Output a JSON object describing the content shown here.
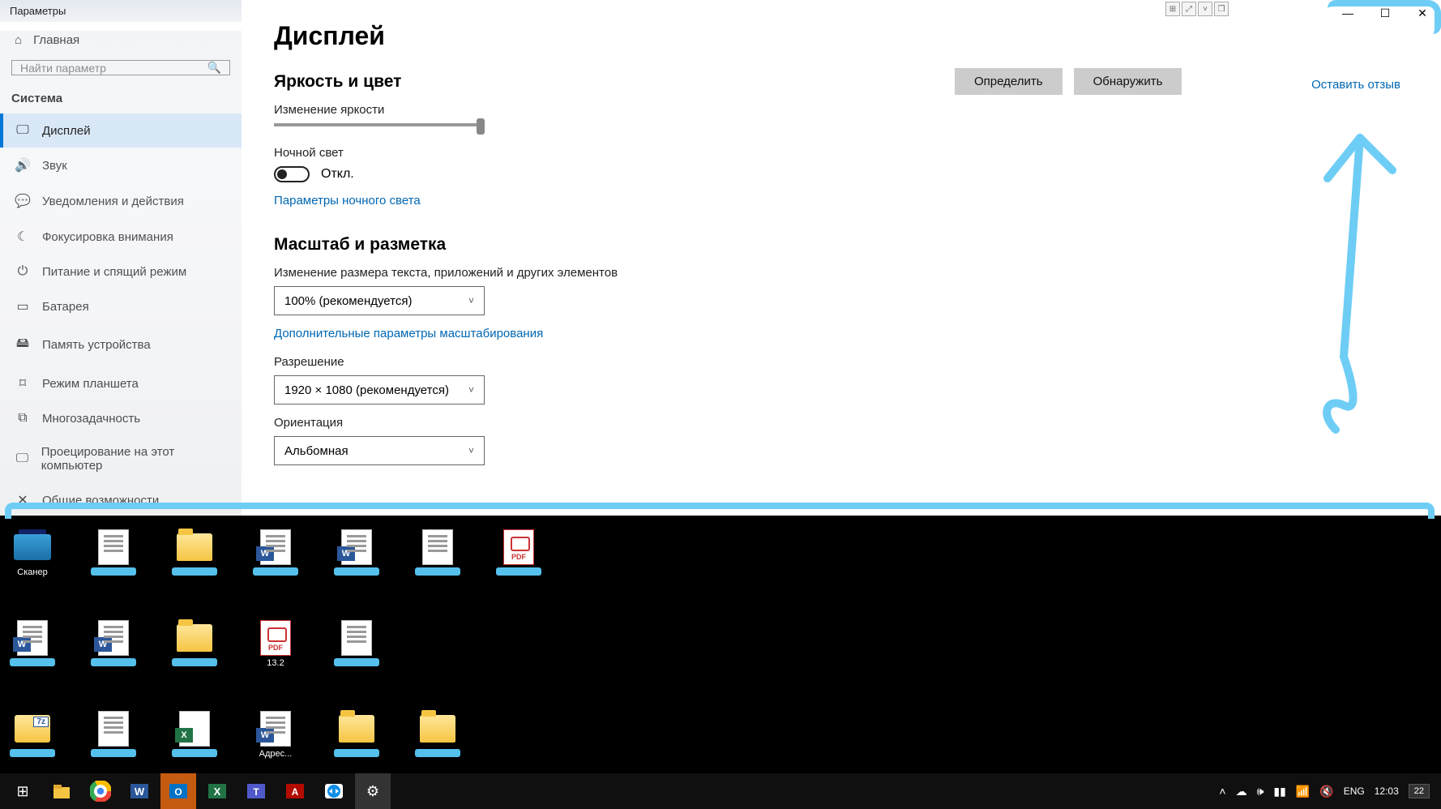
{
  "window": {
    "title": "Параметры",
    "home": "Главная",
    "search_placeholder": "Найти параметр",
    "section": "Система",
    "nav": [
      {
        "icon": "🖵",
        "label": "Дисплей",
        "active": true
      },
      {
        "icon": "🔊",
        "label": "Звук"
      },
      {
        "icon": "💬",
        "label": "Уведомления и действия"
      },
      {
        "icon": "☾",
        "label": "Фокусировка внимания"
      },
      {
        "icon": "⏻",
        "label": "Питание и спящий режим"
      },
      {
        "icon": "▭",
        "label": "Батарея"
      },
      {
        "icon": "🖴",
        "label": "Память устройства"
      },
      {
        "icon": "⌑",
        "label": "Режим планшета"
      },
      {
        "icon": "⧉",
        "label": "Многозадачность"
      },
      {
        "icon": "🖵",
        "label": "Проецирование на этот компьютер"
      },
      {
        "icon": "✕",
        "label": "Общие возможности"
      }
    ]
  },
  "content": {
    "h1": "Дисплей",
    "btn_identify": "Определить",
    "btn_detect": "Обнаружить",
    "feedback": "Оставить отзыв",
    "section_brightness": "Яркость и цвет",
    "lbl_brightness": "Изменение яркости",
    "lbl_nightlight": "Ночной свет",
    "toggle_state": "Откл.",
    "link_nightlight": "Параметры ночного света",
    "section_scale": "Масштаб и разметка",
    "lbl_scale": "Изменение размера текста, приложений и других элементов",
    "dd_scale": "100% (рекомендуется)",
    "link_scale": "Дополнительные параметры масштабирования",
    "lbl_resolution": "Разрешение",
    "dd_resolution": "1920 × 1080 (рекомендуется)",
    "lbl_orientation": "Ориентация",
    "dd_orientation": "Альбомная"
  },
  "desktop_icons": {
    "row1": [
      {
        "t": "scanner",
        "label": "Сканер"
      },
      {
        "t": "doc",
        "label": ""
      },
      {
        "t": "folder",
        "label": ""
      },
      {
        "t": "word",
        "label": ""
      },
      {
        "t": "word",
        "label": ""
      },
      {
        "t": "doc",
        "label": ""
      },
      {
        "t": "pdf",
        "label": ""
      }
    ],
    "row2": [
      {
        "t": "word",
        "label": ""
      },
      {
        "t": "word",
        "label": ""
      },
      {
        "t": "folder",
        "label": ""
      },
      {
        "t": "pdf",
        "label": "13.2"
      },
      {
        "t": "doc",
        "label": ""
      }
    ],
    "row3": [
      {
        "t": "zip",
        "label": ""
      },
      {
        "t": "doc",
        "label": ""
      },
      {
        "t": "excel",
        "label": ""
      },
      {
        "t": "word",
        "label": "Адрес..."
      },
      {
        "t": "folder",
        "label": ""
      },
      {
        "t": "folder",
        "label": ""
      }
    ]
  },
  "taskbar": {
    "lang": "ENG",
    "time": "12:03",
    "notif": "22"
  }
}
